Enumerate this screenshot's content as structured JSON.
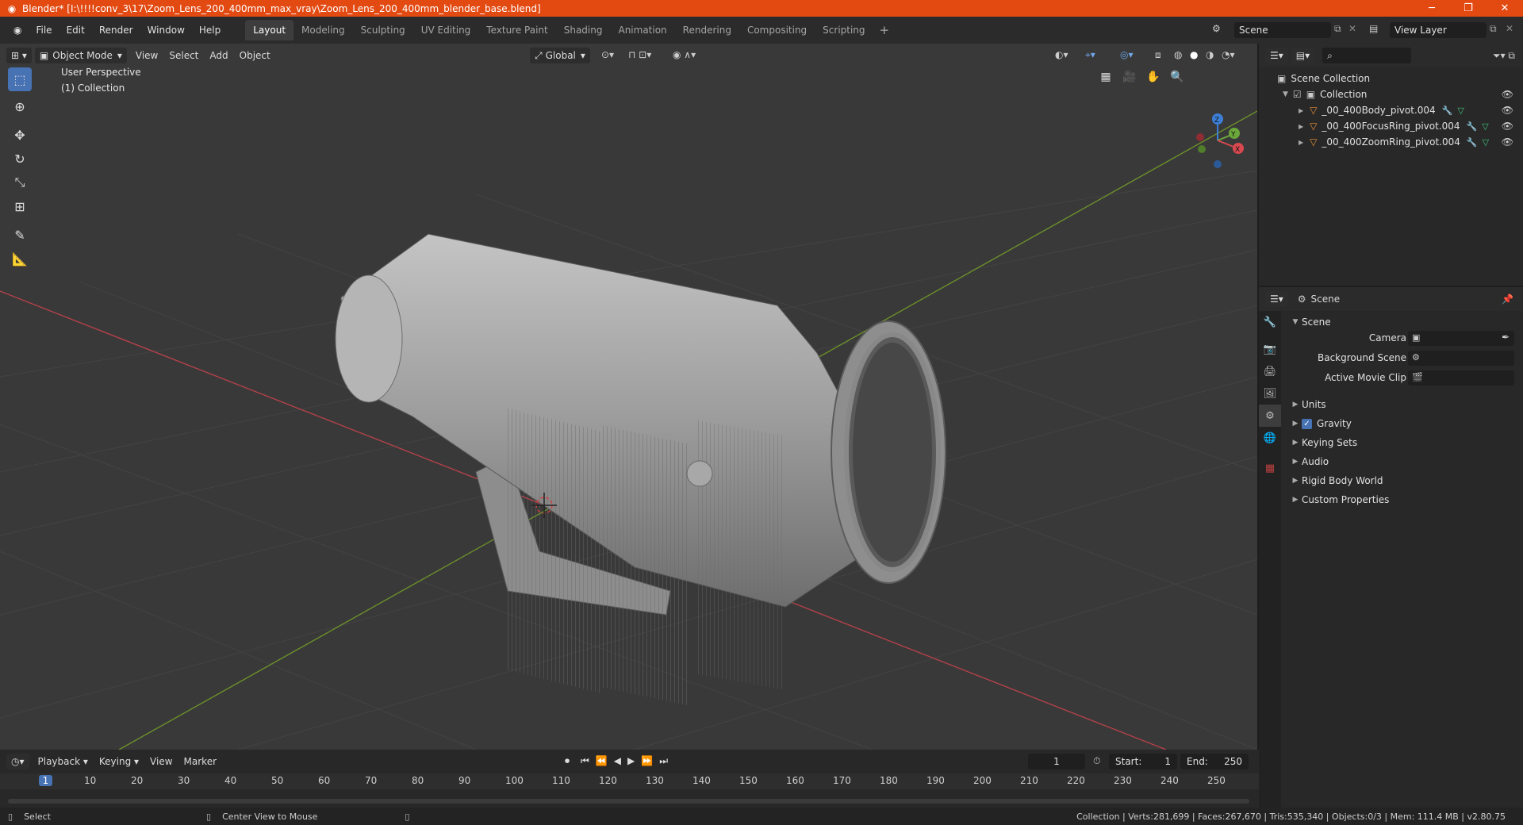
{
  "window": {
    "title": "Blender* [I:\\!!!!conv_3\\17\\Zoom_Lens_200_400mm_max_vray\\Zoom_Lens_200_400mm_blender_base.blend]",
    "minimize": "─",
    "maximize": "❐",
    "close": "✕"
  },
  "menubar": {
    "menus": [
      "File",
      "Edit",
      "Render",
      "Window",
      "Help"
    ],
    "workspaces": [
      "Layout",
      "Modeling",
      "Sculpting",
      "UV Editing",
      "Texture Paint",
      "Shading",
      "Animation",
      "Rendering",
      "Compositing",
      "Scripting"
    ],
    "active_workspace": "Layout",
    "add_tab": "+",
    "scene": "Scene",
    "view_layer": "View Layer"
  },
  "viewport": {
    "mode": "Object Mode",
    "menus": [
      "View",
      "Select",
      "Add",
      "Object"
    ],
    "transform_orientation": "Global",
    "overlay_text_1": "User Perspective",
    "overlay_text_2": "(1) Collection",
    "gizmo_axes": [
      "Z",
      "Y",
      "X"
    ],
    "colors": {
      "background": "#393939",
      "x_axis": "#b3414a",
      "y_axis": "#6b8f2a",
      "lens": "#9a9a9a"
    }
  },
  "outliner": {
    "root": "Scene Collection",
    "collection": "Collection",
    "objects": [
      "_00_400Body_pivot.004",
      "_00_400FocusRing_pivot.004",
      "_00_400ZoomRing_pivot.004"
    ]
  },
  "properties": {
    "context": "Scene",
    "panel": "Scene",
    "fields": [
      {
        "label": "Camera"
      },
      {
        "label": "Background Scene"
      },
      {
        "label": "Active Movie Clip"
      }
    ],
    "sections": [
      "Units",
      "Gravity",
      "Keying Sets",
      "Audio",
      "Rigid Body World",
      "Custom Properties"
    ],
    "gravity_checked": true
  },
  "timeline": {
    "menus": [
      "Playback",
      "Keying",
      "View",
      "Marker"
    ],
    "current_frame": "1",
    "start_label": "Start:",
    "start": "1",
    "end_label": "End:",
    "end": "250",
    "ruler": [
      "1",
      "10",
      "20",
      "30",
      "40",
      "50",
      "60",
      "70",
      "80",
      "90",
      "100",
      "110",
      "120",
      "130",
      "140",
      "150",
      "160",
      "170",
      "180",
      "190",
      "200",
      "210",
      "220",
      "230",
      "240",
      "250"
    ]
  },
  "statusbar": {
    "select": "Select",
    "center": "Center View to Mouse",
    "stats": "Collection | Verts:281,699 | Faces:267,670 | Tris:535,340 | Objects:0/3 | Mem: 111.4 MB | v2.80.75"
  }
}
